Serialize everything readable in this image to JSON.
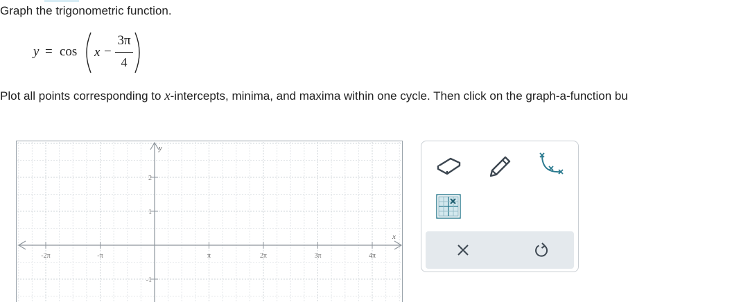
{
  "instruction": "Graph the trigonometric function.",
  "equation": {
    "lhs": "y",
    "equals": "=",
    "func": "cos",
    "variable": "x",
    "minus": "−",
    "numerator": "3π",
    "denominator": "4"
  },
  "plot_instruction": {
    "before": "Plot all points corresponding to ",
    "var": "x",
    "after": "-intercepts, minima, and maxima within one cycle. Then click on the graph-a-function bu"
  },
  "graph": {
    "x_axis_label": "x",
    "y_axis_label": "y",
    "x_ticks": [
      "-2π",
      "-π",
      "π",
      "2π",
      "3π",
      "4π"
    ],
    "y_ticks": [
      "2",
      "1",
      "-1"
    ]
  },
  "toolbox": {
    "tools": [
      "eraser-icon",
      "pencil-icon",
      "graph-function-icon",
      "point-grid-icon"
    ],
    "actions": [
      "clear-icon",
      "undo-icon"
    ]
  },
  "colors": {
    "accent": "#2b7a8f",
    "toolbar_bg": "#e4e9ed",
    "icon_dark": "#3c4650"
  }
}
